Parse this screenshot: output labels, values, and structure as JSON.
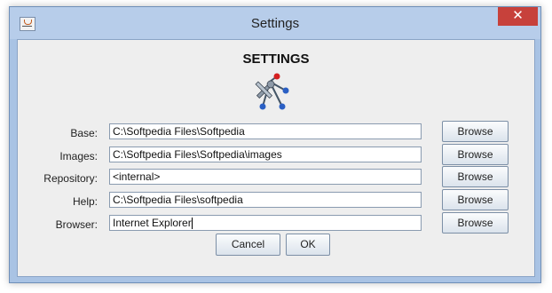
{
  "window": {
    "title": "Settings"
  },
  "header": {
    "heading": "SETTINGS"
  },
  "rows": [
    {
      "label": "Base:",
      "value": "C:\\Softpedia Files\\Softpedia",
      "button": "Browse"
    },
    {
      "label": "Images:",
      "value": "C:\\Softpedia Files\\Softpedia\\images",
      "button": "Browse"
    },
    {
      "label": "Repository:",
      "value": "<internal>",
      "button": "Browse"
    },
    {
      "label": "Help:",
      "value": "C:\\Softpedia Files\\softpedia",
      "button": "Browse"
    },
    {
      "label": "Browser:",
      "value": "Internet Explorer",
      "button": "Browse"
    }
  ],
  "footer": {
    "cancel_label": "Cancel",
    "ok_label": "OK"
  },
  "icons": {
    "close": "close-icon",
    "app": "java-cup-icon",
    "tools": "tools-icon"
  },
  "colors": {
    "close_button": "#c7413b",
    "title_bar": "#b7cdea",
    "panel": "#eeeeee"
  }
}
